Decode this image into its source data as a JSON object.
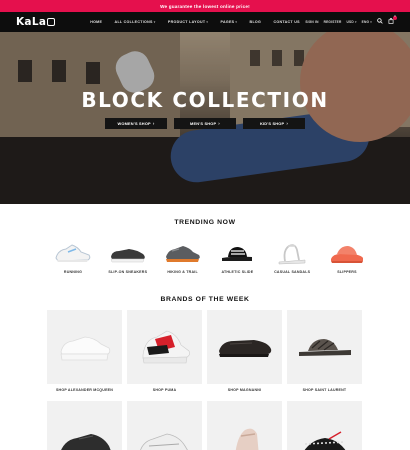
{
  "promo": {
    "text": "We guarantee the lowest online price!"
  },
  "nav": {
    "logo": "KaLa",
    "menu": [
      {
        "label": "HOME",
        "caret": false
      },
      {
        "label": "ALL COLLECTIONS",
        "caret": true
      },
      {
        "label": "PRODUCT LAYOUT",
        "caret": true
      },
      {
        "label": "PAGES",
        "caret": true
      },
      {
        "label": "BLOG",
        "caret": false
      },
      {
        "label": "CONTACT US",
        "caret": false
      }
    ],
    "util": {
      "signin": "SIGN IN",
      "register": "REGISTER",
      "currency": "USD",
      "language": "ENG"
    },
    "cart_count": "0",
    "icons": [
      "search-icon",
      "bag-icon"
    ]
  },
  "hero": {
    "title": "BLOCK COLLECTION",
    "buttons": [
      "WOMEN'S SHOP",
      "MEN'S SHOP",
      "KID'S SHOP"
    ],
    "chevron": "›"
  },
  "trending": {
    "title": "TRENDING NOW",
    "items": [
      {
        "label": "RUNNING",
        "icon": "running-shoe-icon"
      },
      {
        "label": "SLIP-ON SNEAKERS",
        "icon": "slip-on-icon"
      },
      {
        "label": "HIKING & TRAIL",
        "icon": "hiking-shoe-icon"
      },
      {
        "label": "ATHLETIC SLIDE",
        "icon": "slide-icon"
      },
      {
        "label": "CASUAL SANDALS",
        "icon": "sandal-icon"
      },
      {
        "label": "SLIPPERS",
        "icon": "slipper-icon"
      }
    ]
  },
  "brands": {
    "title": "BRANDS OF THE WEEK",
    "items": [
      {
        "label": "SHOP ALEXANDER MCQUEEN"
      },
      {
        "label": "SHOP PUMA"
      },
      {
        "label": "SHOP MAGNANNI"
      },
      {
        "label": "SHOP SAINT LAURENT"
      },
      {
        "label": ""
      },
      {
        "label": ""
      },
      {
        "label": ""
      },
      {
        "label": ""
      }
    ]
  },
  "colors": {
    "accent": "#e5104d",
    "nav_bg": "#0d0d0d",
    "card_bg": "#f1f1f1"
  }
}
